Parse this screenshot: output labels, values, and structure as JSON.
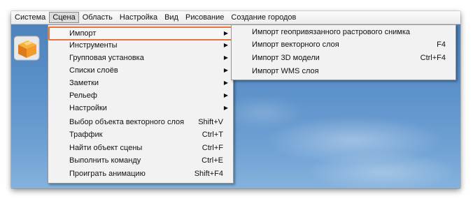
{
  "menubar": {
    "items": [
      {
        "label": "Система"
      },
      {
        "label": "Сцена"
      },
      {
        "label": "Область"
      },
      {
        "label": "Настройка"
      },
      {
        "label": "Вид"
      },
      {
        "label": "Рисование"
      },
      {
        "label": "Создание городов"
      }
    ]
  },
  "scene_menu": {
    "items": [
      {
        "label": "Импорт",
        "shortcut": "",
        "submenu": true
      },
      {
        "label": "Инструменты",
        "shortcut": "",
        "submenu": true
      },
      {
        "label": "Групповая установка",
        "shortcut": "",
        "submenu": true
      },
      {
        "label": "Списки слоёв",
        "shortcut": "",
        "submenu": true
      },
      {
        "label": "Заметки",
        "shortcut": "",
        "submenu": true
      },
      {
        "label": "Рельеф",
        "shortcut": "",
        "submenu": true
      },
      {
        "label": "Настройки",
        "shortcut": "",
        "submenu": true
      },
      {
        "label": "Выбор объекта векторного слоя",
        "shortcut": "Shift+V",
        "submenu": false
      },
      {
        "label": "Траффик",
        "shortcut": "Ctrl+T",
        "submenu": false
      },
      {
        "label": "Найти объект сцены",
        "shortcut": "Ctrl+F",
        "submenu": false
      },
      {
        "label": "Выполнить команду",
        "shortcut": "Ctrl+E",
        "submenu": false
      },
      {
        "label": "Проиграть анимацию",
        "shortcut": "Shift+F4",
        "submenu": false
      }
    ]
  },
  "import_submenu": {
    "items": [
      {
        "label": "Импорт геопривязанного растрового снимка",
        "shortcut": ""
      },
      {
        "label": "Импорт векторного слоя",
        "shortcut": "F4"
      },
      {
        "label": "Импорт 3D модели",
        "shortcut": "Ctrl+F4"
      },
      {
        "label": "Импорт WMS слоя",
        "shortcut": ""
      }
    ]
  },
  "colors": {
    "highlight_border": "#e8743b",
    "menu_bg": "#f2f2f2",
    "desktop_sky": "#5a8fc8"
  },
  "icons": {
    "submenu_arrow": "▶",
    "app_icon": "orange-cube-logo-icon"
  }
}
